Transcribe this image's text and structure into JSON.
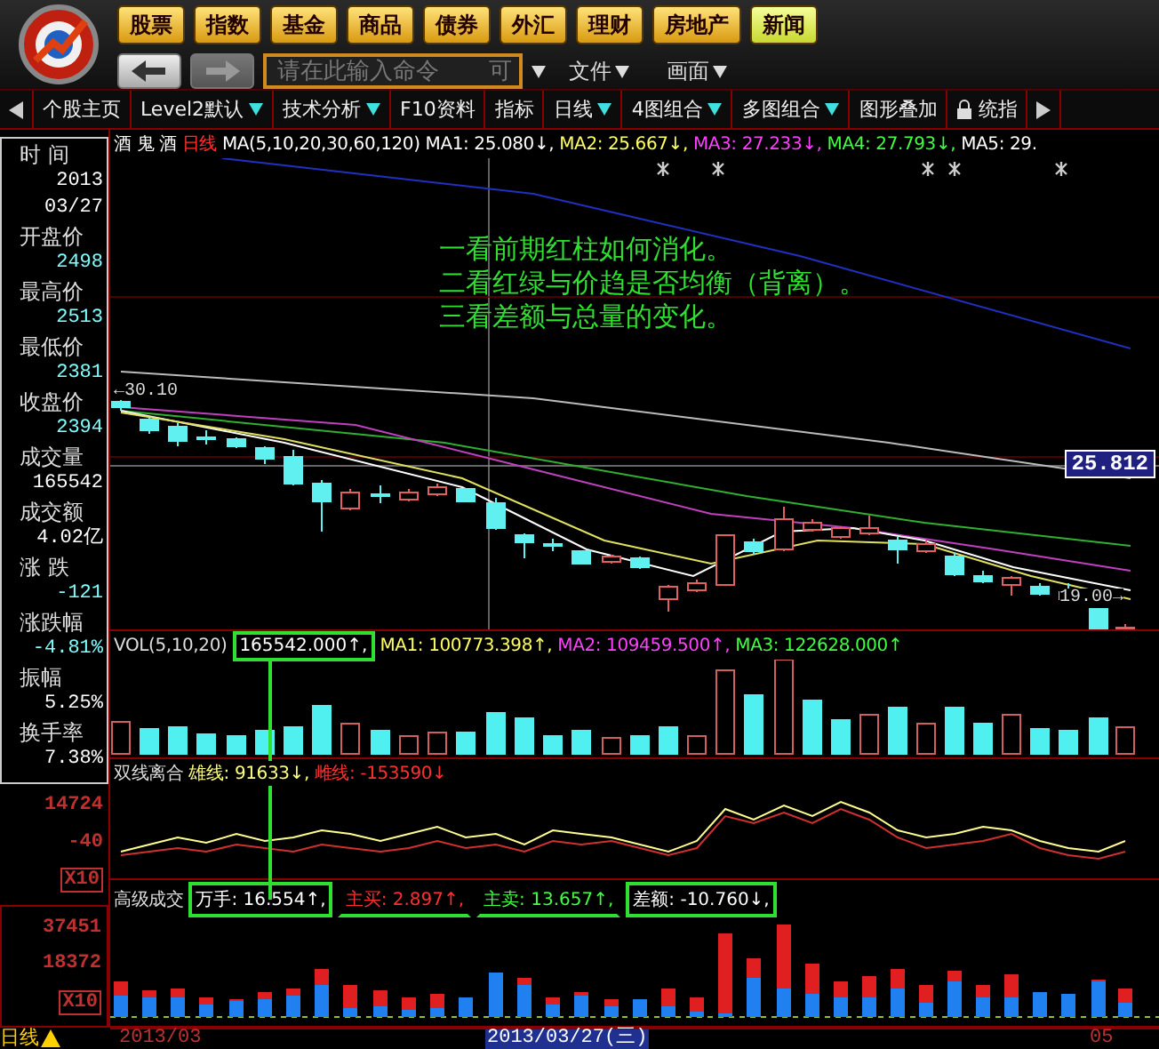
{
  "nav_buttons": [
    {
      "label": "股票",
      "selected": false
    },
    {
      "label": "指数",
      "selected": false
    },
    {
      "label": "基金",
      "selected": false
    },
    {
      "label": "商品",
      "selected": false
    },
    {
      "label": "债券",
      "selected": false
    },
    {
      "label": "外汇",
      "selected": false
    },
    {
      "label": "理财",
      "selected": false
    },
    {
      "label": "房地产",
      "selected": false
    },
    {
      "label": "新闻",
      "selected": true
    }
  ],
  "back_button": {
    "disabled": false
  },
  "forward_button": {
    "disabled": true
  },
  "command_field": {
    "placeholder": "请在此输入命令",
    "suffix": "可"
  },
  "menus": [
    {
      "label": "文件"
    },
    {
      "label": "画面"
    }
  ],
  "tabs": [
    {
      "label": "个股主页",
      "has_menu": false,
      "locked": false
    },
    {
      "label": "Level2默认",
      "has_menu": true,
      "locked": false
    },
    {
      "label": "技术分析",
      "has_menu": true,
      "locked": false
    },
    {
      "label": "F10资料",
      "has_menu": false,
      "locked": false
    },
    {
      "label": "指标",
      "has_menu": false,
      "locked": false
    },
    {
      "label": "日线",
      "has_menu": true,
      "locked": false
    },
    {
      "label": "4图组合",
      "has_menu": true,
      "locked": false
    },
    {
      "label": "多图组合",
      "has_menu": true,
      "locked": false
    },
    {
      "label": "图形叠加",
      "has_menu": false,
      "locked": false
    },
    {
      "label": "统指",
      "has_menu": false,
      "locked": true
    }
  ],
  "info_panel": [
    {
      "label": "时 间",
      "values": [
        "2013",
        "03/27"
      ],
      "color": "#ffffff"
    },
    {
      "label": "开盘价",
      "values": [
        "2498"
      ],
      "color": "#80ffff"
    },
    {
      "label": "最高价",
      "values": [
        "2513"
      ],
      "color": "#80ffff"
    },
    {
      "label": "最低价",
      "values": [
        "2381"
      ],
      "color": "#80ffff"
    },
    {
      "label": "收盘价",
      "values": [
        "2394"
      ],
      "color": "#80ffff"
    },
    {
      "label": "成交量",
      "values": [
        "165542"
      ],
      "color": "#ffffff"
    },
    {
      "label": "成交额",
      "values": [
        "4.02亿"
      ],
      "color": "#ffffff"
    },
    {
      "label": "涨 跌",
      "values": [
        "-121"
      ],
      "color": "#80ffff"
    },
    {
      "label": "涨跌幅",
      "values": [
        "-4.81%"
      ],
      "color": "#80ffff"
    },
    {
      "label": "振幅",
      "values": [
        "5.25%"
      ],
      "color": "#ffffff"
    },
    {
      "label": "换手率",
      "values": [
        "7.38%"
      ],
      "color": "#ffffff"
    }
  ],
  "main_chart": {
    "stock": "酒 鬼 酒",
    "period": "日线",
    "indicator": "MA(5,10,20,30,60,120)",
    "ma_values": [
      {
        "text": "MA1: 25.080↓,",
        "color": "#ffffff"
      },
      {
        "text": "MA2: 25.667↓,",
        "color": "#ffff60"
      },
      {
        "text": "MA3: 27.233↓,",
        "color": "#ff40ff"
      },
      {
        "text": "MA4: 27.793↓,",
        "color": "#40ff40"
      },
      {
        "text": "MA5: 29.",
        "color": "#ffffff"
      }
    ],
    "notes": [
      "一看前期红柱如何消化。",
      "二看红绿与价趋是否均衡（背离）。",
      "三看差额与总量的变化。"
    ],
    "high_label": "←30.10",
    "low_label": "19.00→",
    "price_tag": "25.812"
  },
  "volume": {
    "title": "VOL(5,10,20)",
    "current": "165542.000↑,",
    "ma_values": [
      {
        "text": "MA1: 100773.398↑,",
        "color": "#ffff60"
      },
      {
        "text": "MA2: 109459.500↑,",
        "color": "#ff40ff"
      },
      {
        "text": "MA3: 122628.000↑",
        "color": "#40ff40"
      }
    ]
  },
  "dual_line": {
    "title": "双线离合",
    "items": [
      {
        "text": "雄线: 91633↓,",
        "color": "#ffff80"
      },
      {
        "text": "雌线: -153590↓",
        "color": "#ff3030"
      }
    ],
    "axis": [
      "14724",
      "-40"
    ],
    "scale": "X10"
  },
  "advanced": {
    "title": "高级成交",
    "items": [
      {
        "text": "万手: 16.554↑,",
        "color": "#ffffff",
        "boxed": true,
        "underlined": false
      },
      {
        "text": "主买: 2.897↑,",
        "color": "#ff3030",
        "boxed": false,
        "underlined": true
      },
      {
        "text": "主卖: 13.657↑,",
        "color": "#40ff40",
        "boxed": false,
        "underlined": true
      },
      {
        "text": "差额: -10.760↓,",
        "color": "#ffffff",
        "boxed": true,
        "underlined": false
      }
    ],
    "axis": [
      "37451",
      "18372"
    ],
    "scale": "X10"
  },
  "timeline": {
    "period": "日线",
    "dates": [
      {
        "label": "2013/03",
        "selected": false
      },
      {
        "label": "2013/03/27(三)",
        "selected": true
      },
      {
        "label": "05",
        "selected": false
      }
    ]
  }
}
